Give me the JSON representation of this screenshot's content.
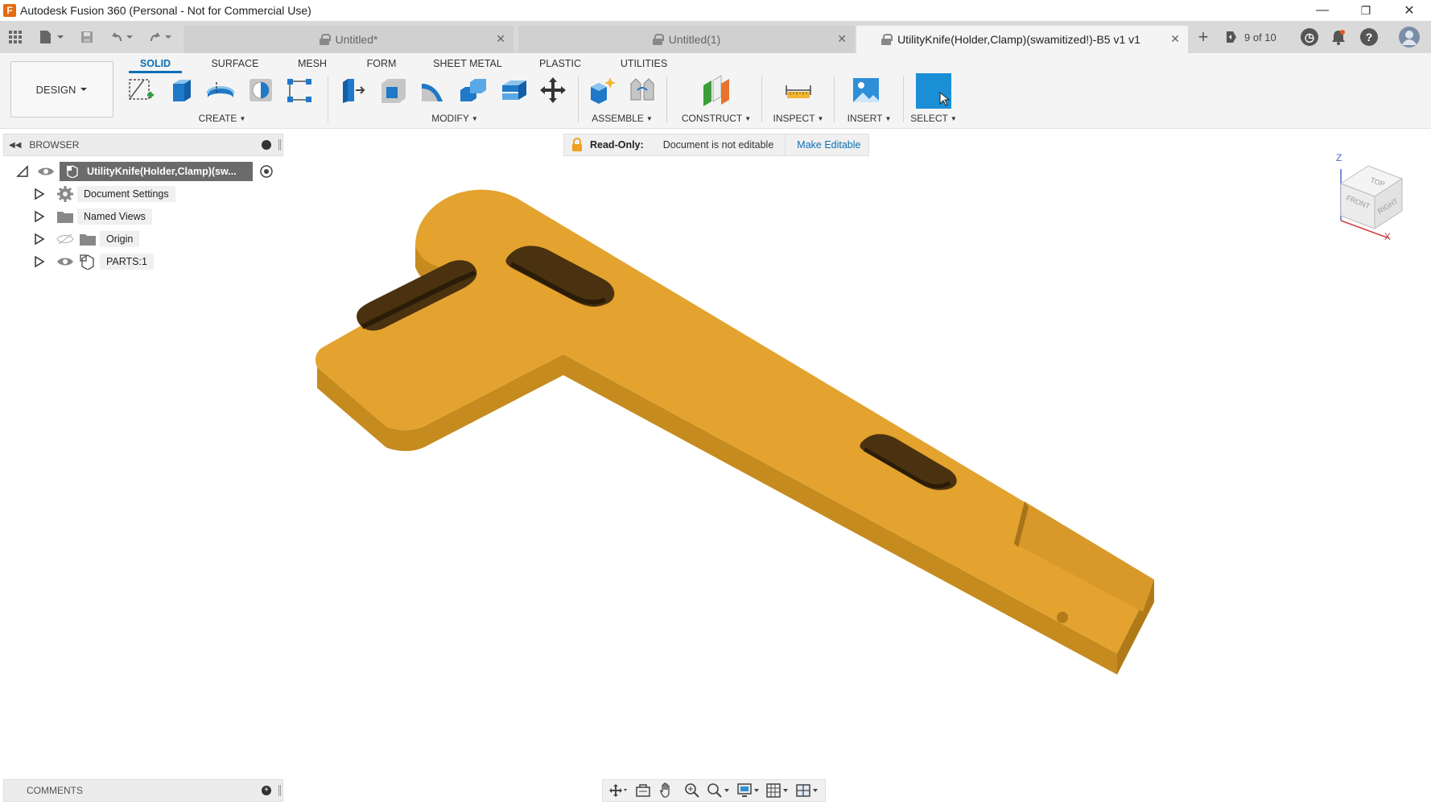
{
  "window": {
    "title": "Autodesk Fusion 360 (Personal - Not for Commercial Use)",
    "minimize": "—",
    "restore": "❐",
    "close": "✕"
  },
  "tabs": [
    {
      "label": "Untitled*",
      "active": false
    },
    {
      "label": "Untitled(1)",
      "active": false
    },
    {
      "label": "UtilityKnife(Holder,Clamp)(swamitized!)-B5 v1 v1",
      "active": true
    }
  ],
  "tabbar": {
    "new_tab": "+",
    "job_status": "9 of 10",
    "close_glyph": "✕"
  },
  "workspace": {
    "mode": "DESIGN",
    "tabs": [
      "SOLID",
      "SURFACE",
      "MESH",
      "FORM",
      "SHEET METAL",
      "PLASTIC",
      "UTILITIES"
    ],
    "active_tab": "SOLID"
  },
  "groups": {
    "create": "CREATE",
    "modify": "MODIFY",
    "assemble": "ASSEMBLE",
    "construct": "CONSTRUCT",
    "inspect": "INSPECT",
    "insert": "INSERT",
    "select": "SELECT"
  },
  "browser": {
    "title": "BROWSER",
    "root": "UtilityKnife(Holder,Clamp)(sw...",
    "items": [
      "Document Settings",
      "Named Views",
      "Origin",
      "PARTS:1"
    ]
  },
  "readonly": {
    "label": "Read-Only:",
    "message": "Document is not editable",
    "action": "Make Editable"
  },
  "comments": {
    "title": "COMMENTS"
  },
  "viewcube": {
    "top": "TOP",
    "front": "FRONT",
    "right": "RIGHT",
    "z": "Z",
    "x": "X"
  },
  "colors": {
    "accent": "#0c6fb5",
    "model_top": "#e3a32e",
    "model_side": "#c58b1f",
    "select_tool": "#1a8fd6"
  }
}
